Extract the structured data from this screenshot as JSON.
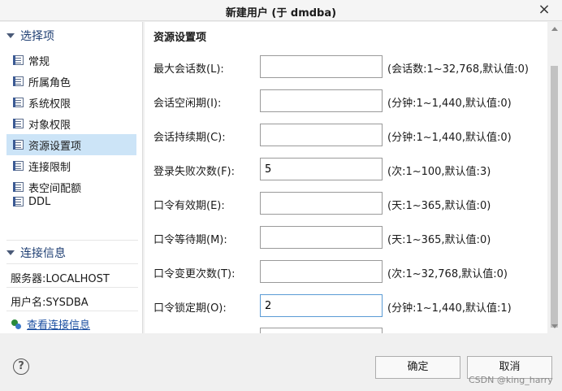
{
  "window": {
    "title": "新建用户   (于 dmdba)",
    "close_icon": "×"
  },
  "sidebar": {
    "select_header": "选择项",
    "items": [
      {
        "label": "常规",
        "icon": "page-icon",
        "selected": false
      },
      {
        "label": "所属角色",
        "icon": "page-icon",
        "selected": false
      },
      {
        "label": "系统权限",
        "icon": "page-icon",
        "selected": false
      },
      {
        "label": "对象权限",
        "icon": "page-icon",
        "selected": false
      },
      {
        "label": "资源设置项",
        "icon": "page-icon",
        "selected": true
      },
      {
        "label": "连接限制",
        "icon": "page-icon",
        "selected": false
      },
      {
        "label": "表空间配额",
        "icon": "page-icon",
        "selected": false
      },
      {
        "label": "DDL",
        "icon": "page-icon",
        "selected": false
      }
    ],
    "connection_header": "连接信息",
    "server": "服务器:LOCALHOST",
    "username": "用户名:SYSDBA",
    "view_link": "查看连接信息"
  },
  "content": {
    "heading": "资源设置项",
    "rows": [
      {
        "label": "最大会话数(L):",
        "value": "",
        "hint": "(会话数:1~32,768,默认值:0)"
      },
      {
        "label": "会话空闲期(I):",
        "value": "",
        "hint": "(分钟:1~1,440,默认值:0)"
      },
      {
        "label": "会话持续期(C):",
        "value": "",
        "hint": "(分钟:1~1,440,默认值:0)"
      },
      {
        "label": "登录失败次数(F):",
        "value": "5",
        "hint": "(次:1~100,默认值:3)"
      },
      {
        "label": "口令有效期(E):",
        "value": "",
        "hint": "(天:1~365,默认值:0)"
      },
      {
        "label": "口令等待期(M):",
        "value": "",
        "hint": "(天:1~365,默认值:0)"
      },
      {
        "label": "口令变更次数(T):",
        "value": "",
        "hint": "(次:1~32,768,默认值:0)"
      },
      {
        "label": "口令锁定期(O):",
        "value": "2",
        "hint": "(分钟:1~1,440,默认值:1)"
      }
    ]
  },
  "footer": {
    "help_icon": "?",
    "ok_label": "确定",
    "cancel_label": "取消",
    "watermark": "CSDN @king_harry"
  }
}
